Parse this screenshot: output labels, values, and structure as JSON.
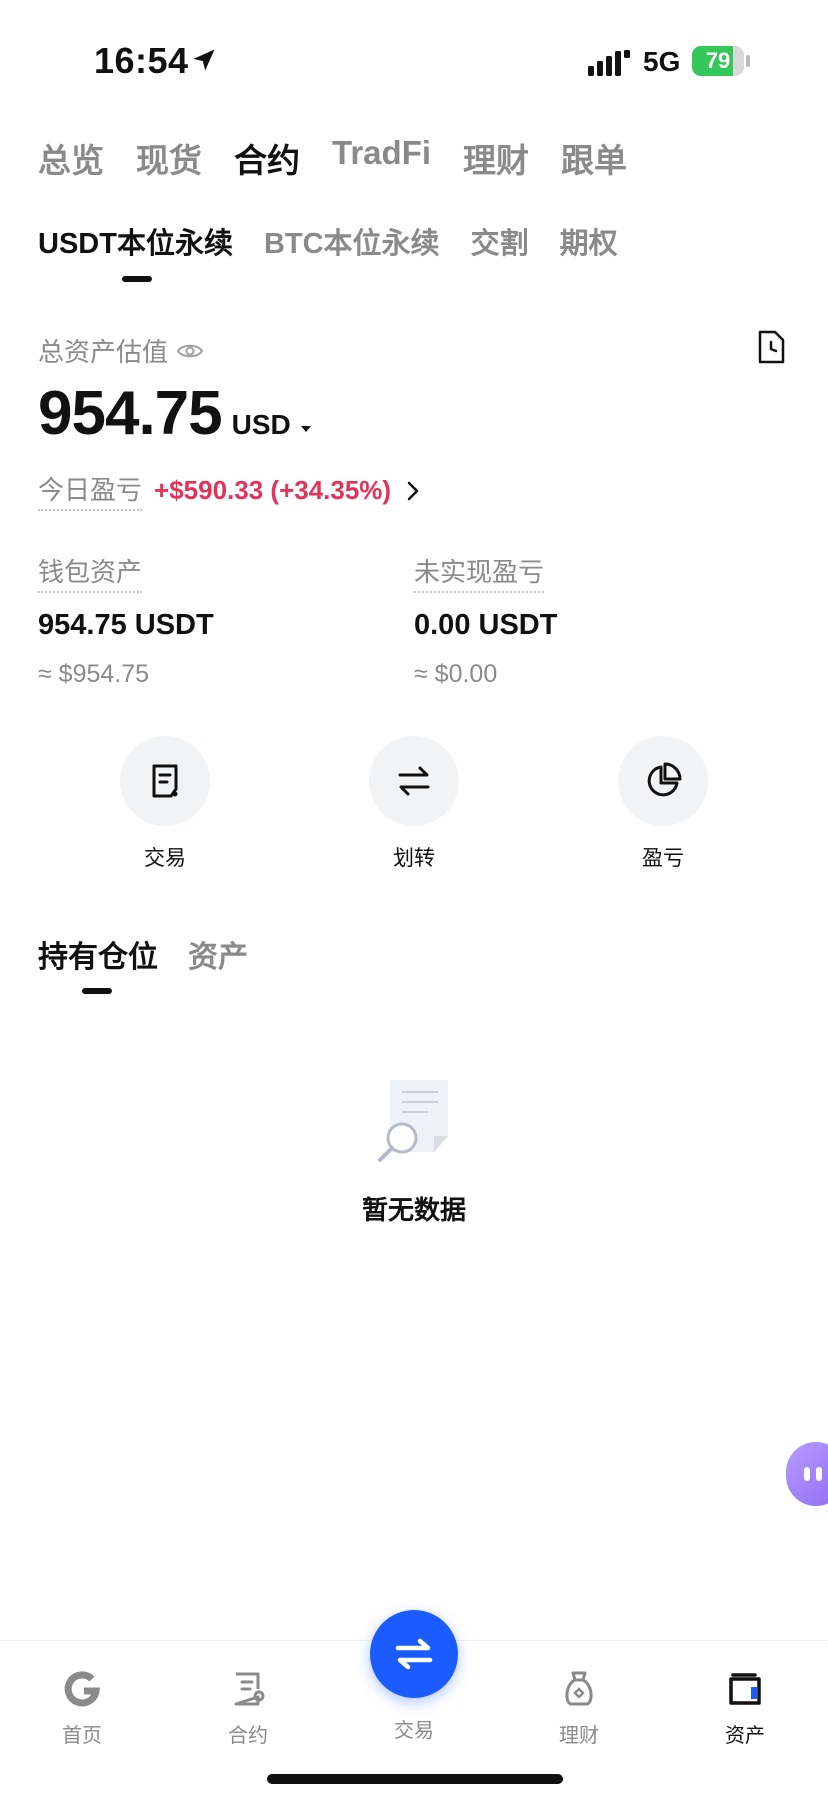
{
  "status_bar": {
    "time": "16:54",
    "network": "5G",
    "battery_level": 79,
    "battery_text": "79"
  },
  "top_tabs": [
    {
      "label": "总览",
      "active": false
    },
    {
      "label": "现货",
      "active": false
    },
    {
      "label": "合约",
      "active": true
    },
    {
      "label": "TradFi",
      "active": false
    },
    {
      "label": "理财",
      "active": false
    },
    {
      "label": "跟单",
      "active": false
    }
  ],
  "sub_tabs": [
    {
      "label": "USDT本位永续",
      "active": true
    },
    {
      "label": "BTC本位永续",
      "active": false
    },
    {
      "label": "交割",
      "active": false
    },
    {
      "label": "期权",
      "active": false
    }
  ],
  "summary": {
    "total_label": "总资产估值",
    "total_value": "954.75",
    "currency": "USD",
    "pnl_label": "今日盈亏",
    "pnl_value": "+$590.33 (+34.35%)"
  },
  "stats": {
    "wallet": {
      "label": "钱包资产",
      "value": "954.75 USDT",
      "approx": "≈ $954.75"
    },
    "unrealized": {
      "label": "未实现盈亏",
      "value": "0.00 USDT",
      "approx": "≈ $0.00"
    }
  },
  "actions": [
    {
      "label": "交易",
      "icon": "trade-icon"
    },
    {
      "label": "划转",
      "icon": "transfer-icon"
    },
    {
      "label": "盈亏",
      "icon": "pie-chart-icon"
    }
  ],
  "position_tabs": [
    {
      "label": "持有仓位",
      "active": true
    },
    {
      "label": "资产",
      "active": false
    }
  ],
  "empty_state": {
    "text": "暂无数据"
  },
  "bottom_nav": [
    {
      "label": "首页",
      "icon": "home-icon",
      "active": false
    },
    {
      "label": "合约",
      "icon": "futures-icon",
      "active": false
    },
    {
      "label": "交易",
      "icon": "swap-icon",
      "active": false
    },
    {
      "label": "理财",
      "icon": "earn-icon",
      "active": false
    },
    {
      "label": "资产",
      "icon": "wallet-icon",
      "active": true
    }
  ],
  "colors": {
    "accent": "#1a5cff",
    "profit": "#e4335b",
    "battery": "#34c759"
  }
}
